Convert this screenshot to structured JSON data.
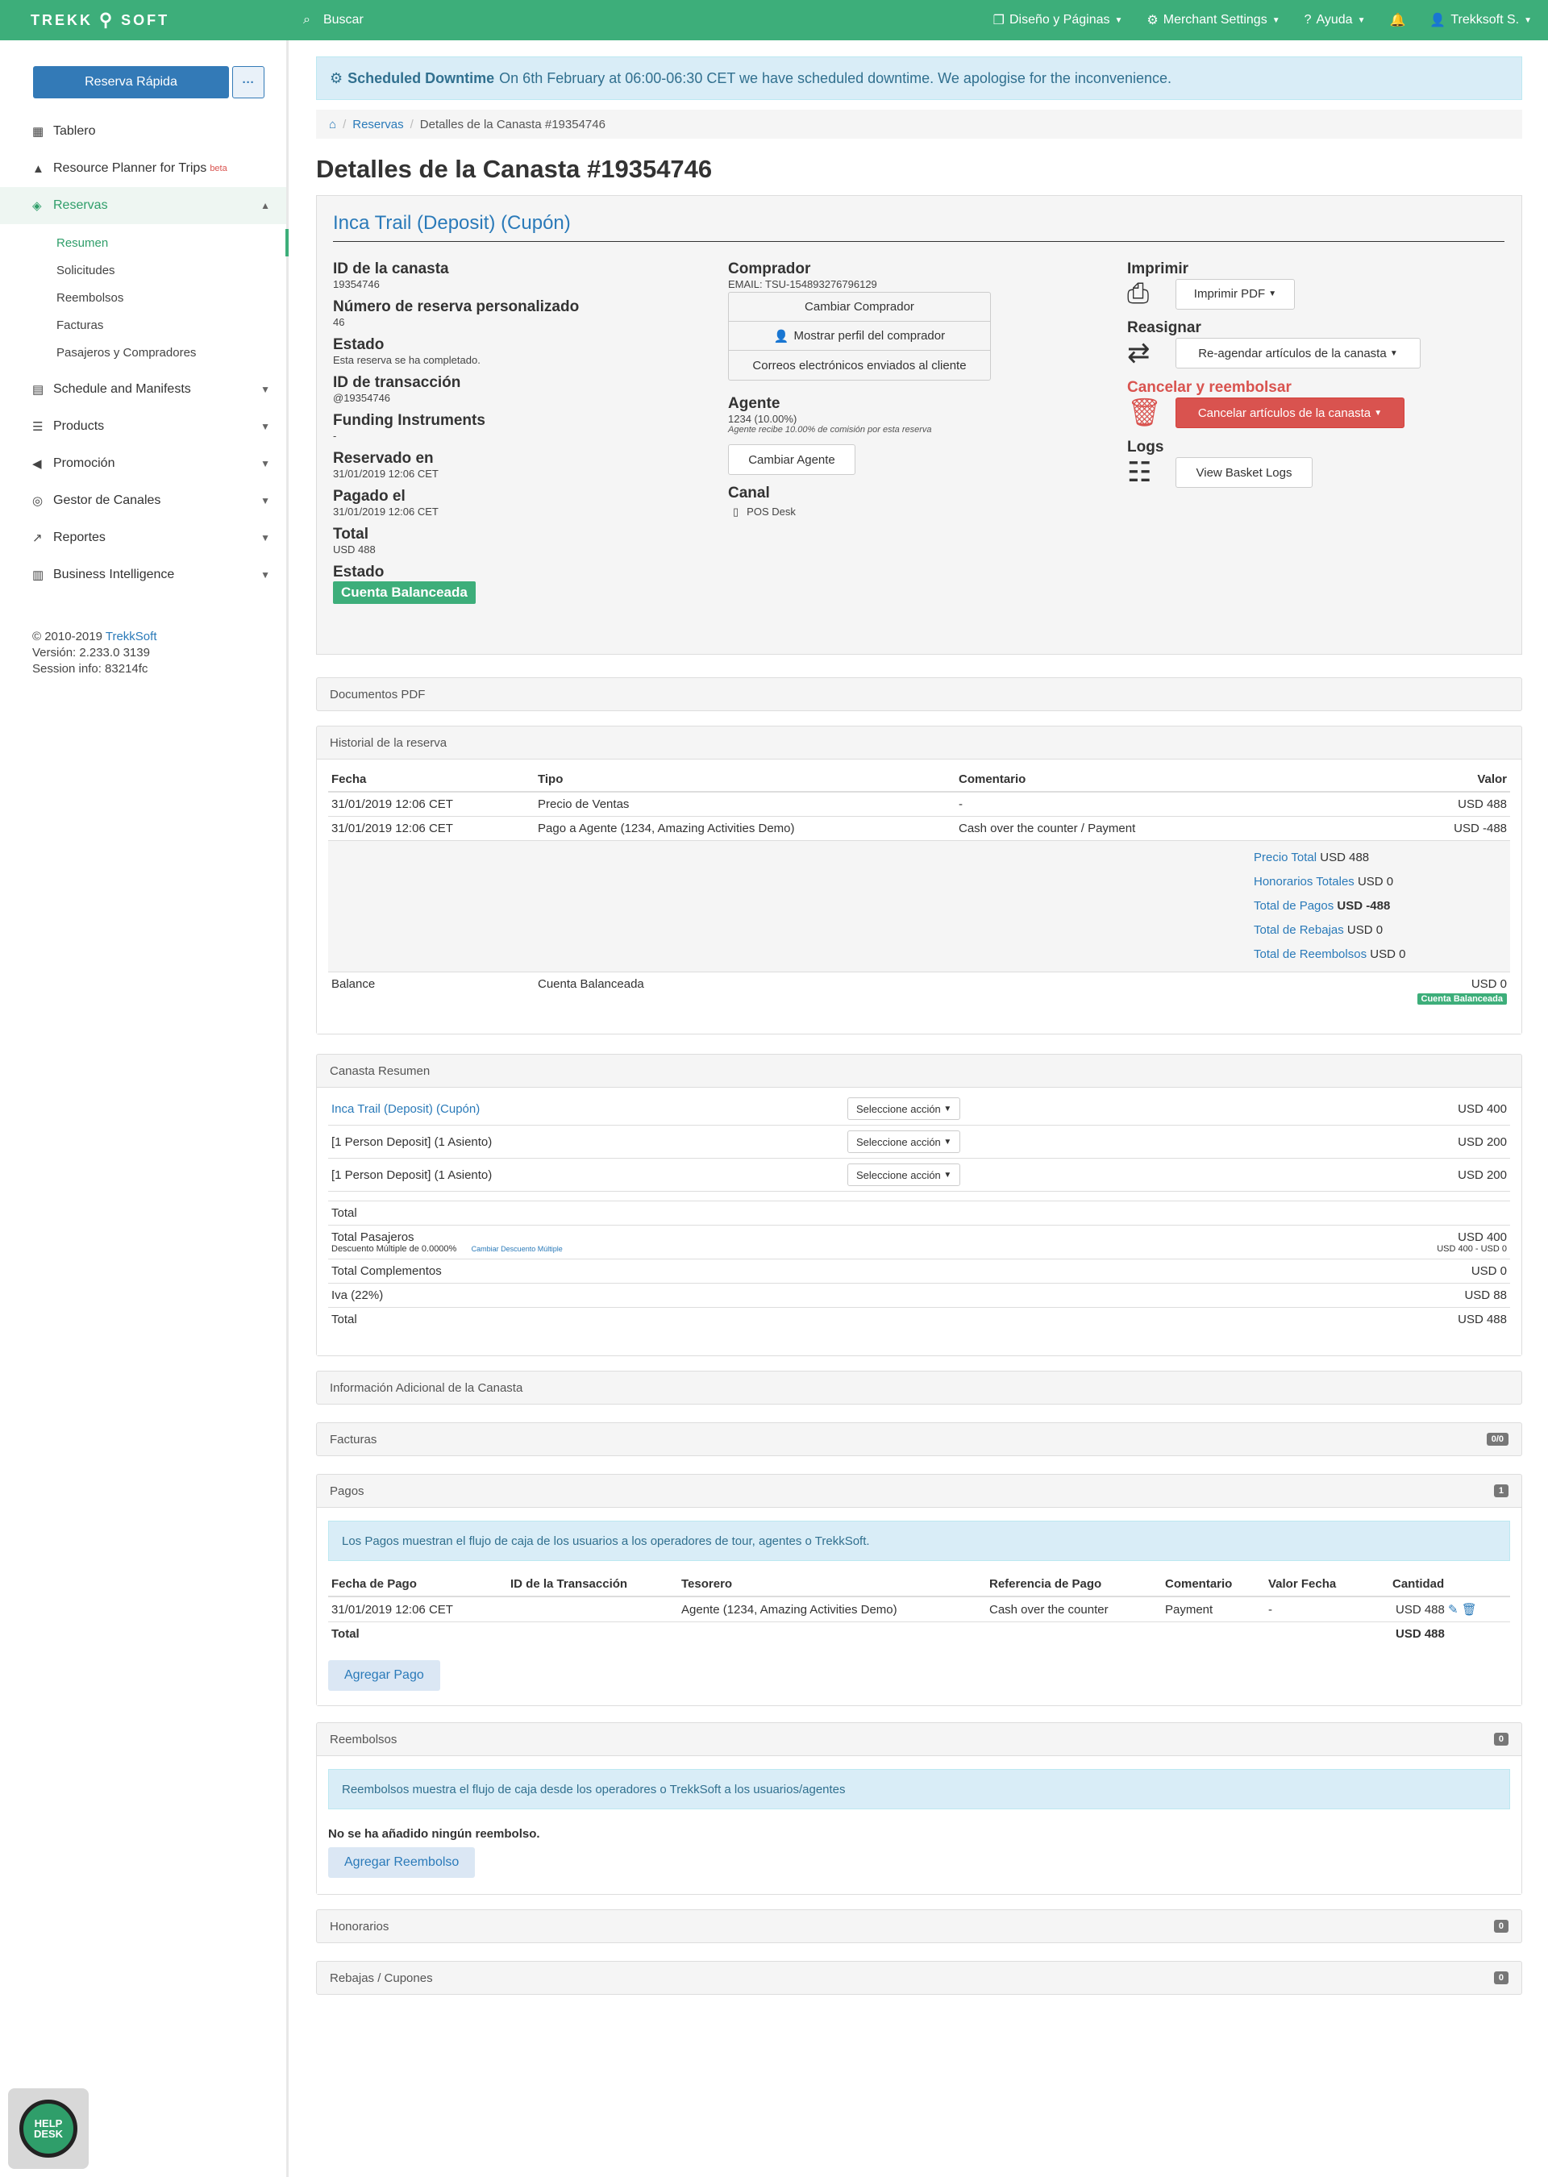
{
  "topbar": {
    "logo_left": "TREKK",
    "logo_right": "SOFT",
    "search_label": "Buscar",
    "design": "Diseño y Páginas",
    "merchant": "Merchant Settings",
    "help": "Ayuda",
    "user": "Trekksoft S."
  },
  "sidebar": {
    "quick_booking": "Reserva Rápida",
    "more": "···",
    "dashboard": "Tablero",
    "resource_planner": "Resource Planner for Trips",
    "resource_planner_badge": "beta",
    "reservations": "Reservas",
    "sub": [
      "Resumen",
      "Solicitudes",
      "Reembolsos",
      "Facturas",
      "Pasajeros y Compradores"
    ],
    "schedule": "Schedule and Manifests",
    "products": "Products",
    "promotion": "Promoción",
    "channels": "Gestor de Canales",
    "reports": "Reportes",
    "bi": "Business Intelligence",
    "copyright": "© 2010-2019",
    "copyright_link": "TrekkSoft",
    "version": "Versión: 2.233.0 3139",
    "session": "Session info: 83214fc",
    "helpdesk": "HELP DESK"
  },
  "alert": {
    "title": "Scheduled Downtime",
    "text": "On 6th February at 06:00-06:30 CET we have scheduled downtime. We apologise for the inconvenience."
  },
  "breadcrumb": {
    "home": "⌂",
    "reservations": "Reservas",
    "current": "Detalles de la Canasta #19354746"
  },
  "page_title": "Detalles de la Canasta #19354746",
  "basket": {
    "title": "Inca Trail (Deposit) (Cupón)",
    "id_label": "ID de la canasta",
    "id_value": "19354746",
    "custom_label": "Número de reserva personalizado",
    "custom_value": "46",
    "status_label": "Estado",
    "status_value": "Esta reserva se ha completado.",
    "tx_label": "ID de transacción",
    "tx_value": "@19354746",
    "funding_label": "Funding Instruments",
    "funding_value": "-",
    "booked_label": "Reservado en",
    "booked_value": "31/01/2019 12:06 CET",
    "paid_label": "Pagado el",
    "paid_value": "31/01/2019 12:06 CET",
    "total_label": "Total",
    "total_value": "USD 488",
    "state_label": "Estado",
    "state_value": "Cuenta Balanceada",
    "buyer_label": "Comprador",
    "buyer_email": "EMAIL: TSU-154893276796129",
    "change_buyer": "Cambiar Comprador",
    "show_buyer": "Mostrar perfil del comprador",
    "emails_sent": "Correos electrónicos enviados al cliente",
    "agent_label": "Agente",
    "agent_value": "1234 (10.00%)",
    "agent_note": "Agente recibe 10.00% de comisión por esta reserva",
    "change_agent": "Cambiar Agente",
    "channel_label": "Canal",
    "channel_value": "POS Desk",
    "print_label": "Imprimir",
    "print_btn": "Imprimir PDF",
    "reassign_label": "Reasignar",
    "reassign_btn": "Re-agendar artículos de la canasta",
    "cancel_label": "Cancelar y reembolsar",
    "cancel_btn": "Cancelar artículos de la canasta",
    "logs_label": "Logs",
    "logs_btn": "View Basket Logs"
  },
  "pdf_panel": "Documentos PDF",
  "history": {
    "title": "Historial de la reserva",
    "headers": [
      "Fecha",
      "Tipo",
      "Comentario",
      "Valor"
    ],
    "rows": [
      [
        "31/01/2019 12:06 CET",
        "Precio de Ventas",
        "-",
        "USD 488"
      ],
      [
        "31/01/2019 12:06 CET",
        "Pago a Agente (1234, Amazing Activities Demo)",
        "Cash over the counter / Payment",
        "USD -488"
      ]
    ],
    "sum_price": "Precio Total",
    "sum_price_v": "USD 488",
    "sum_fees": "Honorarios Totales",
    "sum_fees_v": "USD 0",
    "sum_pay": "Total de Pagos",
    "sum_pay_v": "USD -488",
    "sum_disc": "Total de Rebajas",
    "sum_disc_v": "USD 0",
    "sum_ref": "Total de Reembolsos",
    "sum_ref_v": "USD 0",
    "balance": "Balance",
    "balance_type": "Cuenta Balanceada",
    "balance_v": "USD 0",
    "balance_badge": "Cuenta Balanceada"
  },
  "summary": {
    "title": "Canasta Resumen",
    "items": [
      {
        "name": "Inca Trail (Deposit) (Cupón)",
        "action": "Seleccione acción",
        "value": "USD 400"
      },
      {
        "name": "[1 Person Deposit] (1 Asiento)",
        "action": "Seleccione acción",
        "value": "USD 200"
      },
      {
        "name": "[1 Person Deposit] (1 Asiento)",
        "action": "Seleccione acción",
        "value": "USD 200"
      }
    ],
    "total": "Total",
    "pax": "Total Pasajeros",
    "pax_v": "USD 400",
    "disc": "Descuento Múltiple de 0.0000%",
    "disc_link": "Cambiar Descuento Múltiple",
    "disc_v": "USD 400 - USD 0",
    "addons": "Total Complementos",
    "addons_v": "USD 0",
    "vat": "Iva (22%)",
    "vat_v": "USD 88",
    "grand": "Total",
    "grand_v": "USD 488"
  },
  "extra_info": "Información Adicional de la Canasta",
  "invoices": {
    "title": "Facturas",
    "badge": "0/0"
  },
  "payments": {
    "title": "Pagos",
    "badge": "1",
    "info": "Los Pagos muestran el flujo de caja de los usuarios a los operadores de tour, agentes o TrekkSoft.",
    "headers": [
      "Fecha de Pago",
      "ID de la Transacción",
      "Tesorero",
      "Referencia de Pago",
      "Comentario",
      "Valor Fecha",
      "Cantidad"
    ],
    "row": [
      "31/01/2019 12:06 CET",
      "",
      "Agente (1234, Amazing Activities Demo)",
      "Cash over the counter",
      "Payment",
      "-",
      "USD 488"
    ],
    "total": "Total",
    "total_v": "USD 488",
    "add": "Agregar Pago"
  },
  "refunds": {
    "title": "Reembolsos",
    "badge": "0",
    "info": "Reembolsos muestra el flujo de caja desde los operadores o TrekkSoft a los usuarios/agentes",
    "empty": "No se ha añadido ningún reembolso.",
    "add": "Agregar Reembolso"
  },
  "fees": {
    "title": "Honorarios",
    "badge": "0"
  },
  "discounts": {
    "title": "Rebajas / Cupones",
    "badge": "0"
  },
  "colors": {
    "brand": "#3dae7a",
    "primary": "#337ab7",
    "danger": "#d9534f"
  }
}
